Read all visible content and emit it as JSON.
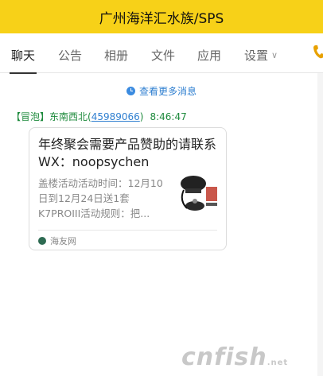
{
  "header": {
    "title": "广州海洋汇水族/SPS"
  },
  "tabs": [
    {
      "label": "聊天",
      "active": true
    },
    {
      "label": "公告"
    },
    {
      "label": "相册"
    },
    {
      "label": "文件"
    },
    {
      "label": "应用"
    },
    {
      "label": "设置"
    }
  ],
  "icons": {
    "phone": "phone-icon",
    "clock": "clock-icon",
    "chevron": "chevron-down-icon",
    "source_logo": "haiyou-logo"
  },
  "more_messages": "查看更多消息",
  "message": {
    "tag": "【冒泡】",
    "sender_name": "东南西北(",
    "sender_id": "45989066",
    "sender_close": ")",
    "time": "8:46:47",
    "card": {
      "title": "年终聚会需要产品赞助的请联系WX：noopsychen",
      "description": "盖楼活动活动时间：12月10日到12月24日送1套K7PROIII活动规则：把...",
      "source": "海友网"
    }
  },
  "watermark": {
    "main": "cnfish",
    "suffix": ".net"
  },
  "colors": {
    "header_bg": "#f7d118",
    "link": "#2f7fd0",
    "sender": "#1d8a3c"
  }
}
